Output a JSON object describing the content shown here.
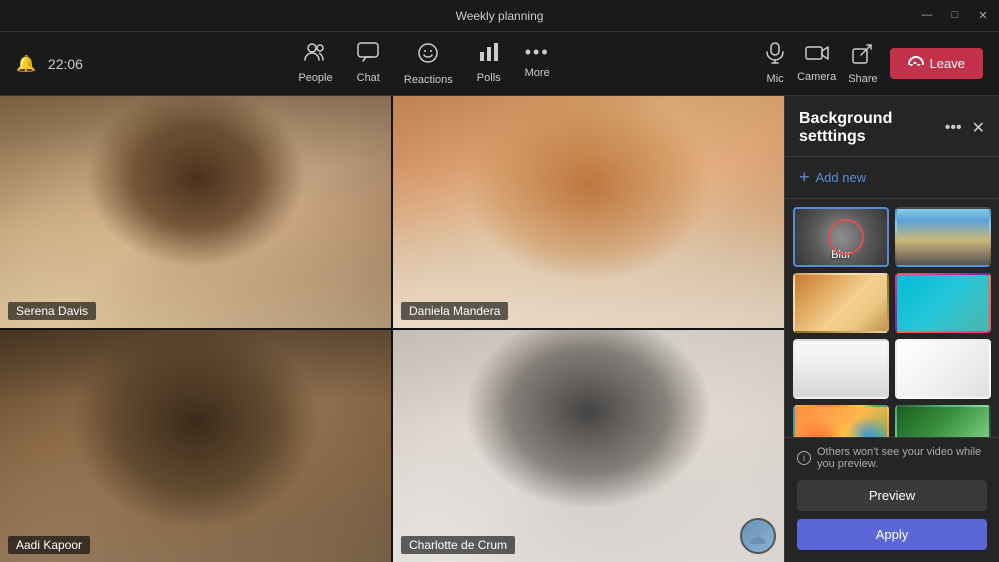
{
  "titleBar": {
    "title": "Weekly planning",
    "controls": {
      "minimize": "—",
      "maximize": "□",
      "close": "✕"
    }
  },
  "toolbar": {
    "time": "22:06",
    "items": [
      {
        "id": "people",
        "label": "People",
        "icon": "👥"
      },
      {
        "id": "chat",
        "label": "Chat",
        "icon": "💬"
      },
      {
        "id": "reactions",
        "label": "Reactions",
        "icon": "😊"
      },
      {
        "id": "polls",
        "label": "Polls",
        "icon": "📊"
      },
      {
        "id": "more",
        "label": "More",
        "icon": "•••"
      }
    ],
    "micLabel": "Mic",
    "cameraLabel": "Camera",
    "shareLabel": "Share",
    "leaveLabel": "Leave"
  },
  "videoGrid": {
    "participants": [
      {
        "id": "p1",
        "name": "Serena Davis"
      },
      {
        "id": "p2",
        "name": "Daniela Mandera"
      },
      {
        "id": "p3",
        "name": "Aadi Kapoor"
      },
      {
        "id": "p4",
        "name": "Charlotte de Crum"
      }
    ]
  },
  "backgroundPanel": {
    "title": "Background setttings",
    "addNewLabel": "+ Add new",
    "moreIcon": "•••",
    "closeIcon": "✕",
    "previewNote": "Others won't see your video while you preview.",
    "previewLabel": "Preview",
    "applyLabel": "Apply",
    "thumbnails": [
      {
        "id": "blur",
        "label": "Blur",
        "type": "blur",
        "selected": true
      },
      {
        "id": "city",
        "label": "",
        "type": "city",
        "selected": false
      },
      {
        "id": "office1",
        "label": "",
        "type": "office1",
        "selected": false
      },
      {
        "id": "colorful",
        "label": "",
        "type": "colorful",
        "selected": false
      },
      {
        "id": "light-room",
        "label": "",
        "type": "light-room",
        "selected": false
      },
      {
        "id": "white-room",
        "label": "",
        "type": "white-room",
        "selected": false
      },
      {
        "id": "balloons",
        "label": "",
        "type": "balloons",
        "selected": false
      },
      {
        "id": "green",
        "label": "",
        "type": "green",
        "selected": false
      }
    ]
  }
}
